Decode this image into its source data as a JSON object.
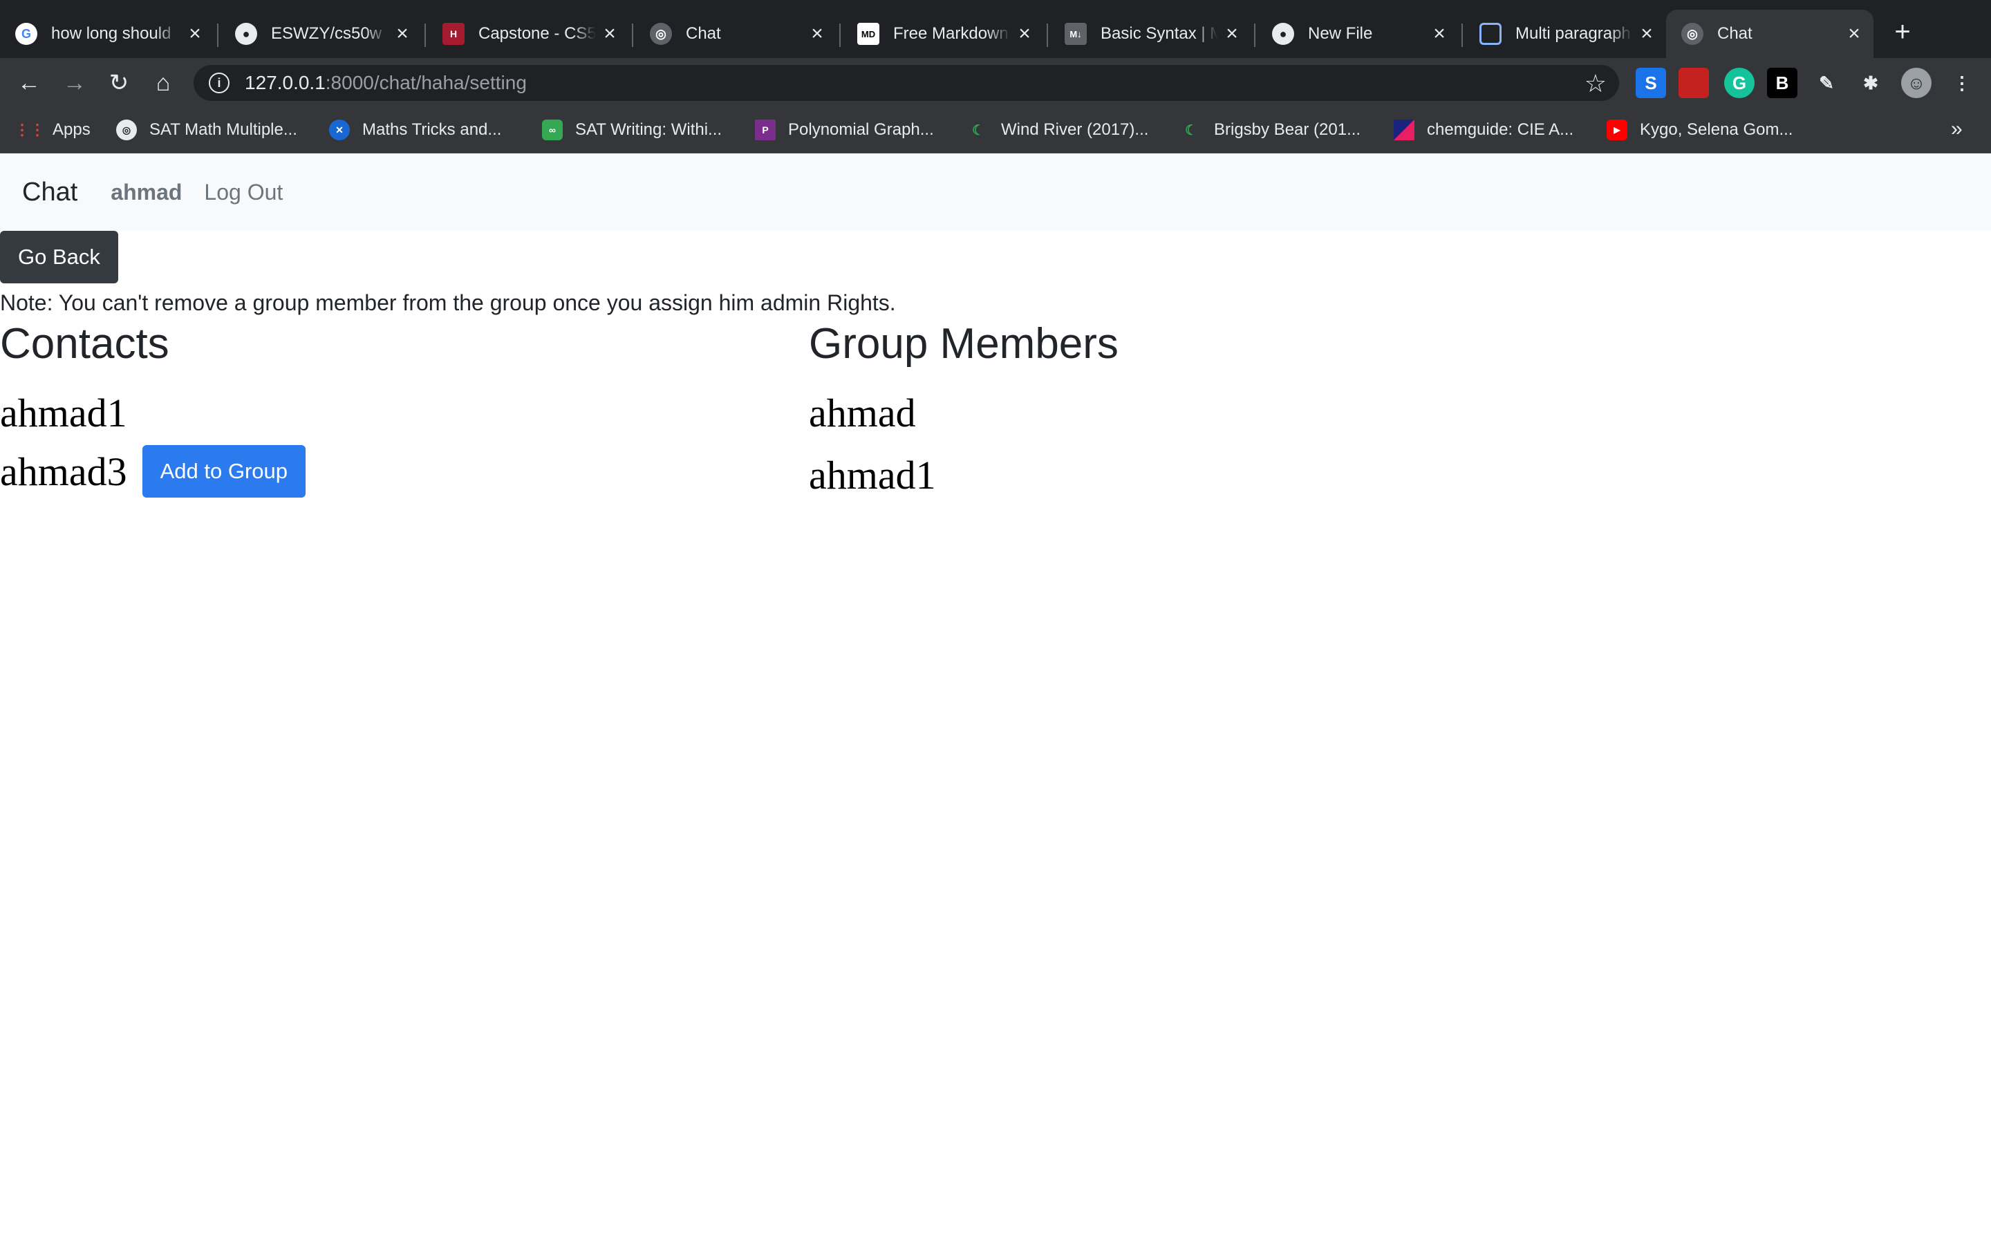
{
  "browser": {
    "tabs": [
      {
        "title": "how long should",
        "icon": "google-icon"
      },
      {
        "title": "ESWZY/cs50w",
        "icon": "github-icon"
      },
      {
        "title": "Capstone - CS5",
        "icon": "harvard-icon"
      },
      {
        "title": "Chat",
        "icon": "globe-icon"
      },
      {
        "title": "Free Markdown",
        "icon": "markdown-icon"
      },
      {
        "title": "Basic Syntax | M",
        "icon": "markdown-icon"
      },
      {
        "title": "New File",
        "icon": "github-icon"
      },
      {
        "title": "Multi paragraph",
        "icon": "page-icon"
      },
      {
        "title": "Chat",
        "icon": "globe-icon",
        "active": true
      }
    ],
    "url_host": "127.0.0.1",
    "url_path": ":8000/chat/haha/setting",
    "bookmarks": [
      {
        "label": "Apps",
        "icon": "apps-grid-icon"
      },
      {
        "label": "SAT Math Multiple...",
        "icon": "globe-icon"
      },
      {
        "label": "Maths Tricks and...",
        "icon": "maths-icon"
      },
      {
        "label": "SAT Writing: Withi...",
        "icon": "sat-icon"
      },
      {
        "label": "Polynomial Graph...",
        "icon": "purple-icon"
      },
      {
        "label": "Wind River (2017)...",
        "icon": "movie-icon"
      },
      {
        "label": "Brigsby Bear (201...",
        "icon": "movie-icon"
      },
      {
        "label": "chemguide: CIE A...",
        "icon": "chem-icon"
      },
      {
        "label": "Kygo, Selena Gom...",
        "icon": "youtube-icon"
      }
    ],
    "extensions": [
      "S",
      "",
      "G",
      "B"
    ]
  },
  "navbar": {
    "brand": "Chat",
    "user": "ahmad",
    "logout": "Log Out"
  },
  "page": {
    "go_back": "Go Back",
    "note": "Note: You can't remove a group member from the group once you assign him admin Rights.",
    "contacts_title": "Contacts",
    "members_title": "Group Members",
    "contacts": [
      {
        "name": "ahmad1",
        "action": ""
      },
      {
        "name": "ahmad3",
        "action": "Add to Group"
      }
    ],
    "members": [
      {
        "name": "ahmad"
      },
      {
        "name": "ahmad1"
      }
    ]
  },
  "colors": {
    "chrome_dark": "#202124",
    "chrome_toolbar": "#35363a",
    "navbar_bg": "#f8f9fa",
    "go_back_bg": "#343a40",
    "primary_button": "#2b7bef"
  }
}
